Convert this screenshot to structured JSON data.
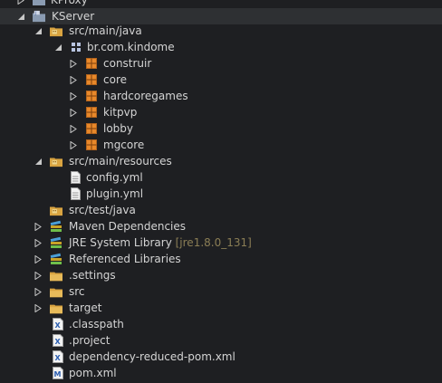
{
  "tree": {
    "items": [
      {
        "label": "KProxy",
        "decoration": "",
        "expanded": false,
        "icon": "project-folder-icon"
      },
      {
        "label": "KServer",
        "decoration": "",
        "expanded": true,
        "icon": "java-project-icon"
      },
      {
        "label": "src/main/java",
        "decoration": "",
        "expanded": true,
        "icon": "source-folder-icon"
      },
      {
        "label": "br.com.kindome",
        "decoration": "",
        "expanded": true,
        "icon": "package-group-icon"
      },
      {
        "label": "construir",
        "decoration": "",
        "expanded": false,
        "icon": "package-icon"
      },
      {
        "label": "core",
        "decoration": "",
        "expanded": false,
        "icon": "package-icon"
      },
      {
        "label": "hardcoregames",
        "decoration": "",
        "expanded": false,
        "icon": "package-icon"
      },
      {
        "label": "kitpvp",
        "decoration": "",
        "expanded": false,
        "icon": "package-icon"
      },
      {
        "label": "lobby",
        "decoration": "",
        "expanded": false,
        "icon": "package-icon"
      },
      {
        "label": "mgcore",
        "decoration": "",
        "expanded": false,
        "icon": "package-icon"
      },
      {
        "label": "src/main/resources",
        "decoration": "",
        "expanded": true,
        "icon": "source-folder-icon"
      },
      {
        "label": "config.yml",
        "decoration": "",
        "expanded": null,
        "icon": "file-icon"
      },
      {
        "label": "plugin.yml",
        "decoration": "",
        "expanded": null,
        "icon": "file-icon"
      },
      {
        "label": "src/test/java",
        "decoration": "",
        "expanded": null,
        "icon": "source-folder-icon"
      },
      {
        "label": "Maven Dependencies",
        "decoration": "",
        "expanded": false,
        "icon": "library-icon"
      },
      {
        "label": "JRE System Library",
        "decoration": "[jre1.8.0_131]",
        "expanded": false,
        "icon": "library-icon"
      },
      {
        "label": "Referenced Libraries",
        "decoration": "",
        "expanded": false,
        "icon": "library-icon"
      },
      {
        "label": ".settings",
        "decoration": "",
        "expanded": false,
        "icon": "folder-icon"
      },
      {
        "label": "src",
        "decoration": "",
        "expanded": false,
        "icon": "folder-icon"
      },
      {
        "label": "target",
        "decoration": "",
        "expanded": false,
        "icon": "folder-icon"
      },
      {
        "label": ".classpath",
        "decoration": "",
        "expanded": null,
        "icon": "xml-file-icon"
      },
      {
        "label": ".project",
        "decoration": "",
        "expanded": null,
        "icon": "xml-file-icon"
      },
      {
        "label": "dependency-reduced-pom.xml",
        "decoration": "",
        "expanded": null,
        "icon": "xml-file-icon"
      },
      {
        "label": "pom.xml",
        "decoration": "",
        "expanded": null,
        "icon": "maven-pom-icon"
      }
    ]
  },
  "colors": {
    "background": "#1e1f22",
    "selected_row": "#2e3033",
    "text": "#d4d4d4",
    "decoration": "#8b7e55",
    "package": "#e8882a",
    "folder": "#d9a441",
    "library": "#4a9fd8",
    "xml": "#5a8fd6"
  }
}
